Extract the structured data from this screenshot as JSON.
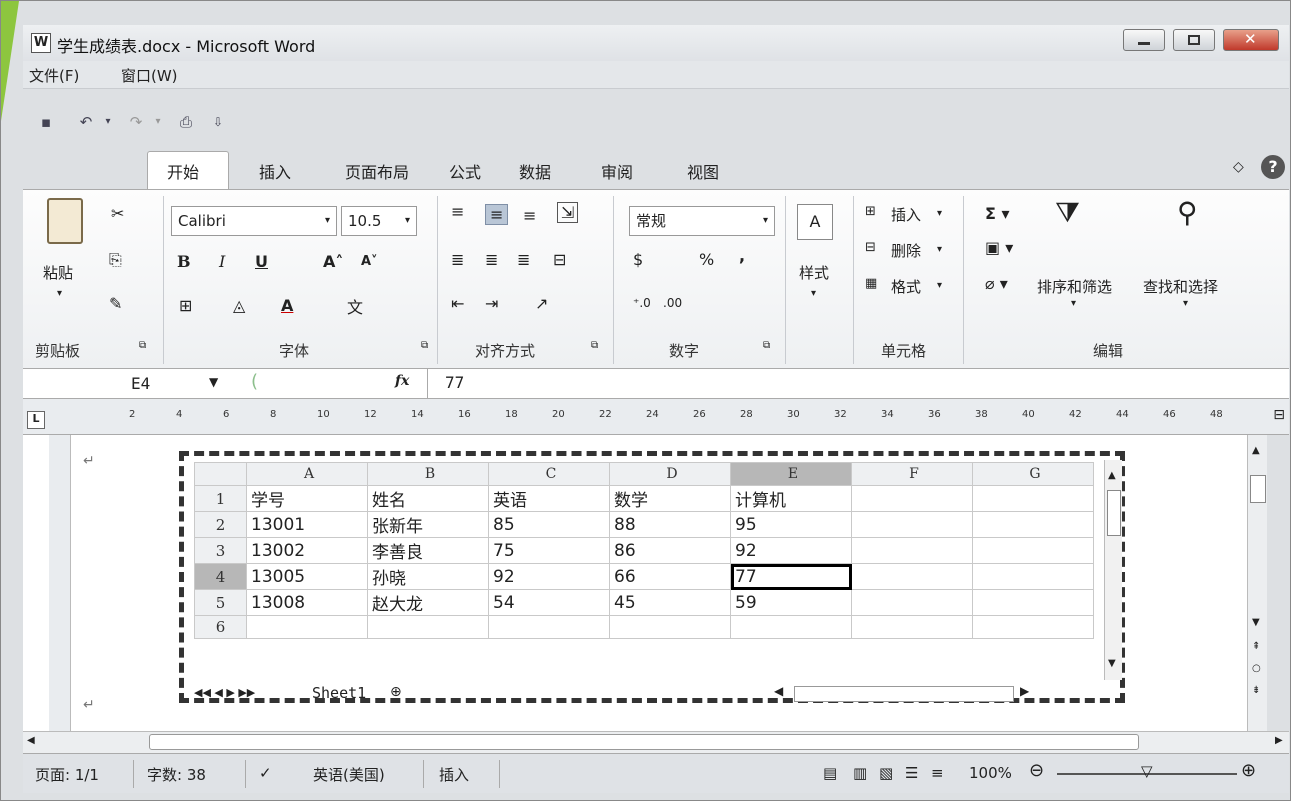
{
  "window": {
    "title": "学生成绩表.docx - Microsoft Word",
    "app_icon": "W"
  },
  "menu": {
    "file": "文件(F)",
    "window": "窗口(W)"
  },
  "tabs": [
    "开始",
    "插入",
    "页面布局",
    "公式",
    "数据",
    "审阅",
    "视图"
  ],
  "ribbon": {
    "paste": "粘贴",
    "clipboard_group": "剪贴板",
    "font_name": "Calibri",
    "font_size": "10.5",
    "font_group": "字体",
    "align_group": "对齐方式",
    "number_format": "常规",
    "number_group": "数字",
    "percent": "%",
    "comma": ",",
    "styles": "样式",
    "insert_cells": "插入",
    "delete_cells": "删除",
    "format_cells": "格式",
    "cells_group": "单元格",
    "sort_filter": "排序和筛选",
    "find_select": "查找和选择",
    "editing_group": "编辑",
    "bold": "B",
    "italic": "I",
    "underline": "U"
  },
  "formula_bar": {
    "name_box": "E4",
    "fx": "fx",
    "value": "77"
  },
  "ruler_ticks": [
    "2",
    "4",
    "6",
    "8",
    "10",
    "12",
    "14",
    "16",
    "18",
    "20",
    "22",
    "24",
    "26",
    "28",
    "30",
    "32",
    "34",
    "36",
    "38",
    "40",
    "42",
    "44",
    "46",
    "48"
  ],
  "sheet": {
    "columns": [
      "A",
      "B",
      "C",
      "D",
      "E",
      "F",
      "G"
    ],
    "rows": [
      {
        "num": "1",
        "cells": [
          "学号",
          "姓名",
          "英语",
          "数学",
          "计算机",
          "",
          ""
        ]
      },
      {
        "num": "2",
        "cells": [
          "13001",
          "张新年",
          "85",
          "88",
          "95",
          "",
          ""
        ]
      },
      {
        "num": "3",
        "cells": [
          "13002",
          "李善良",
          "75",
          "86",
          "92",
          "",
          ""
        ]
      },
      {
        "num": "4",
        "cells": [
          "13005",
          "孙晓",
          "92",
          "66",
          "77",
          "",
          ""
        ]
      },
      {
        "num": "5",
        "cells": [
          "13008",
          "赵大龙",
          "54",
          "45",
          "59",
          "",
          ""
        ]
      },
      {
        "num": "6",
        "cells": [
          "",
          "",
          "",
          "",
          "",
          "",
          ""
        ]
      }
    ],
    "tab_name": "Sheet1"
  },
  "status": {
    "page": "页面: 1/1",
    "words": "字数: 38",
    "language": "英语(美国)",
    "mode": "插入",
    "zoom": "100%"
  }
}
